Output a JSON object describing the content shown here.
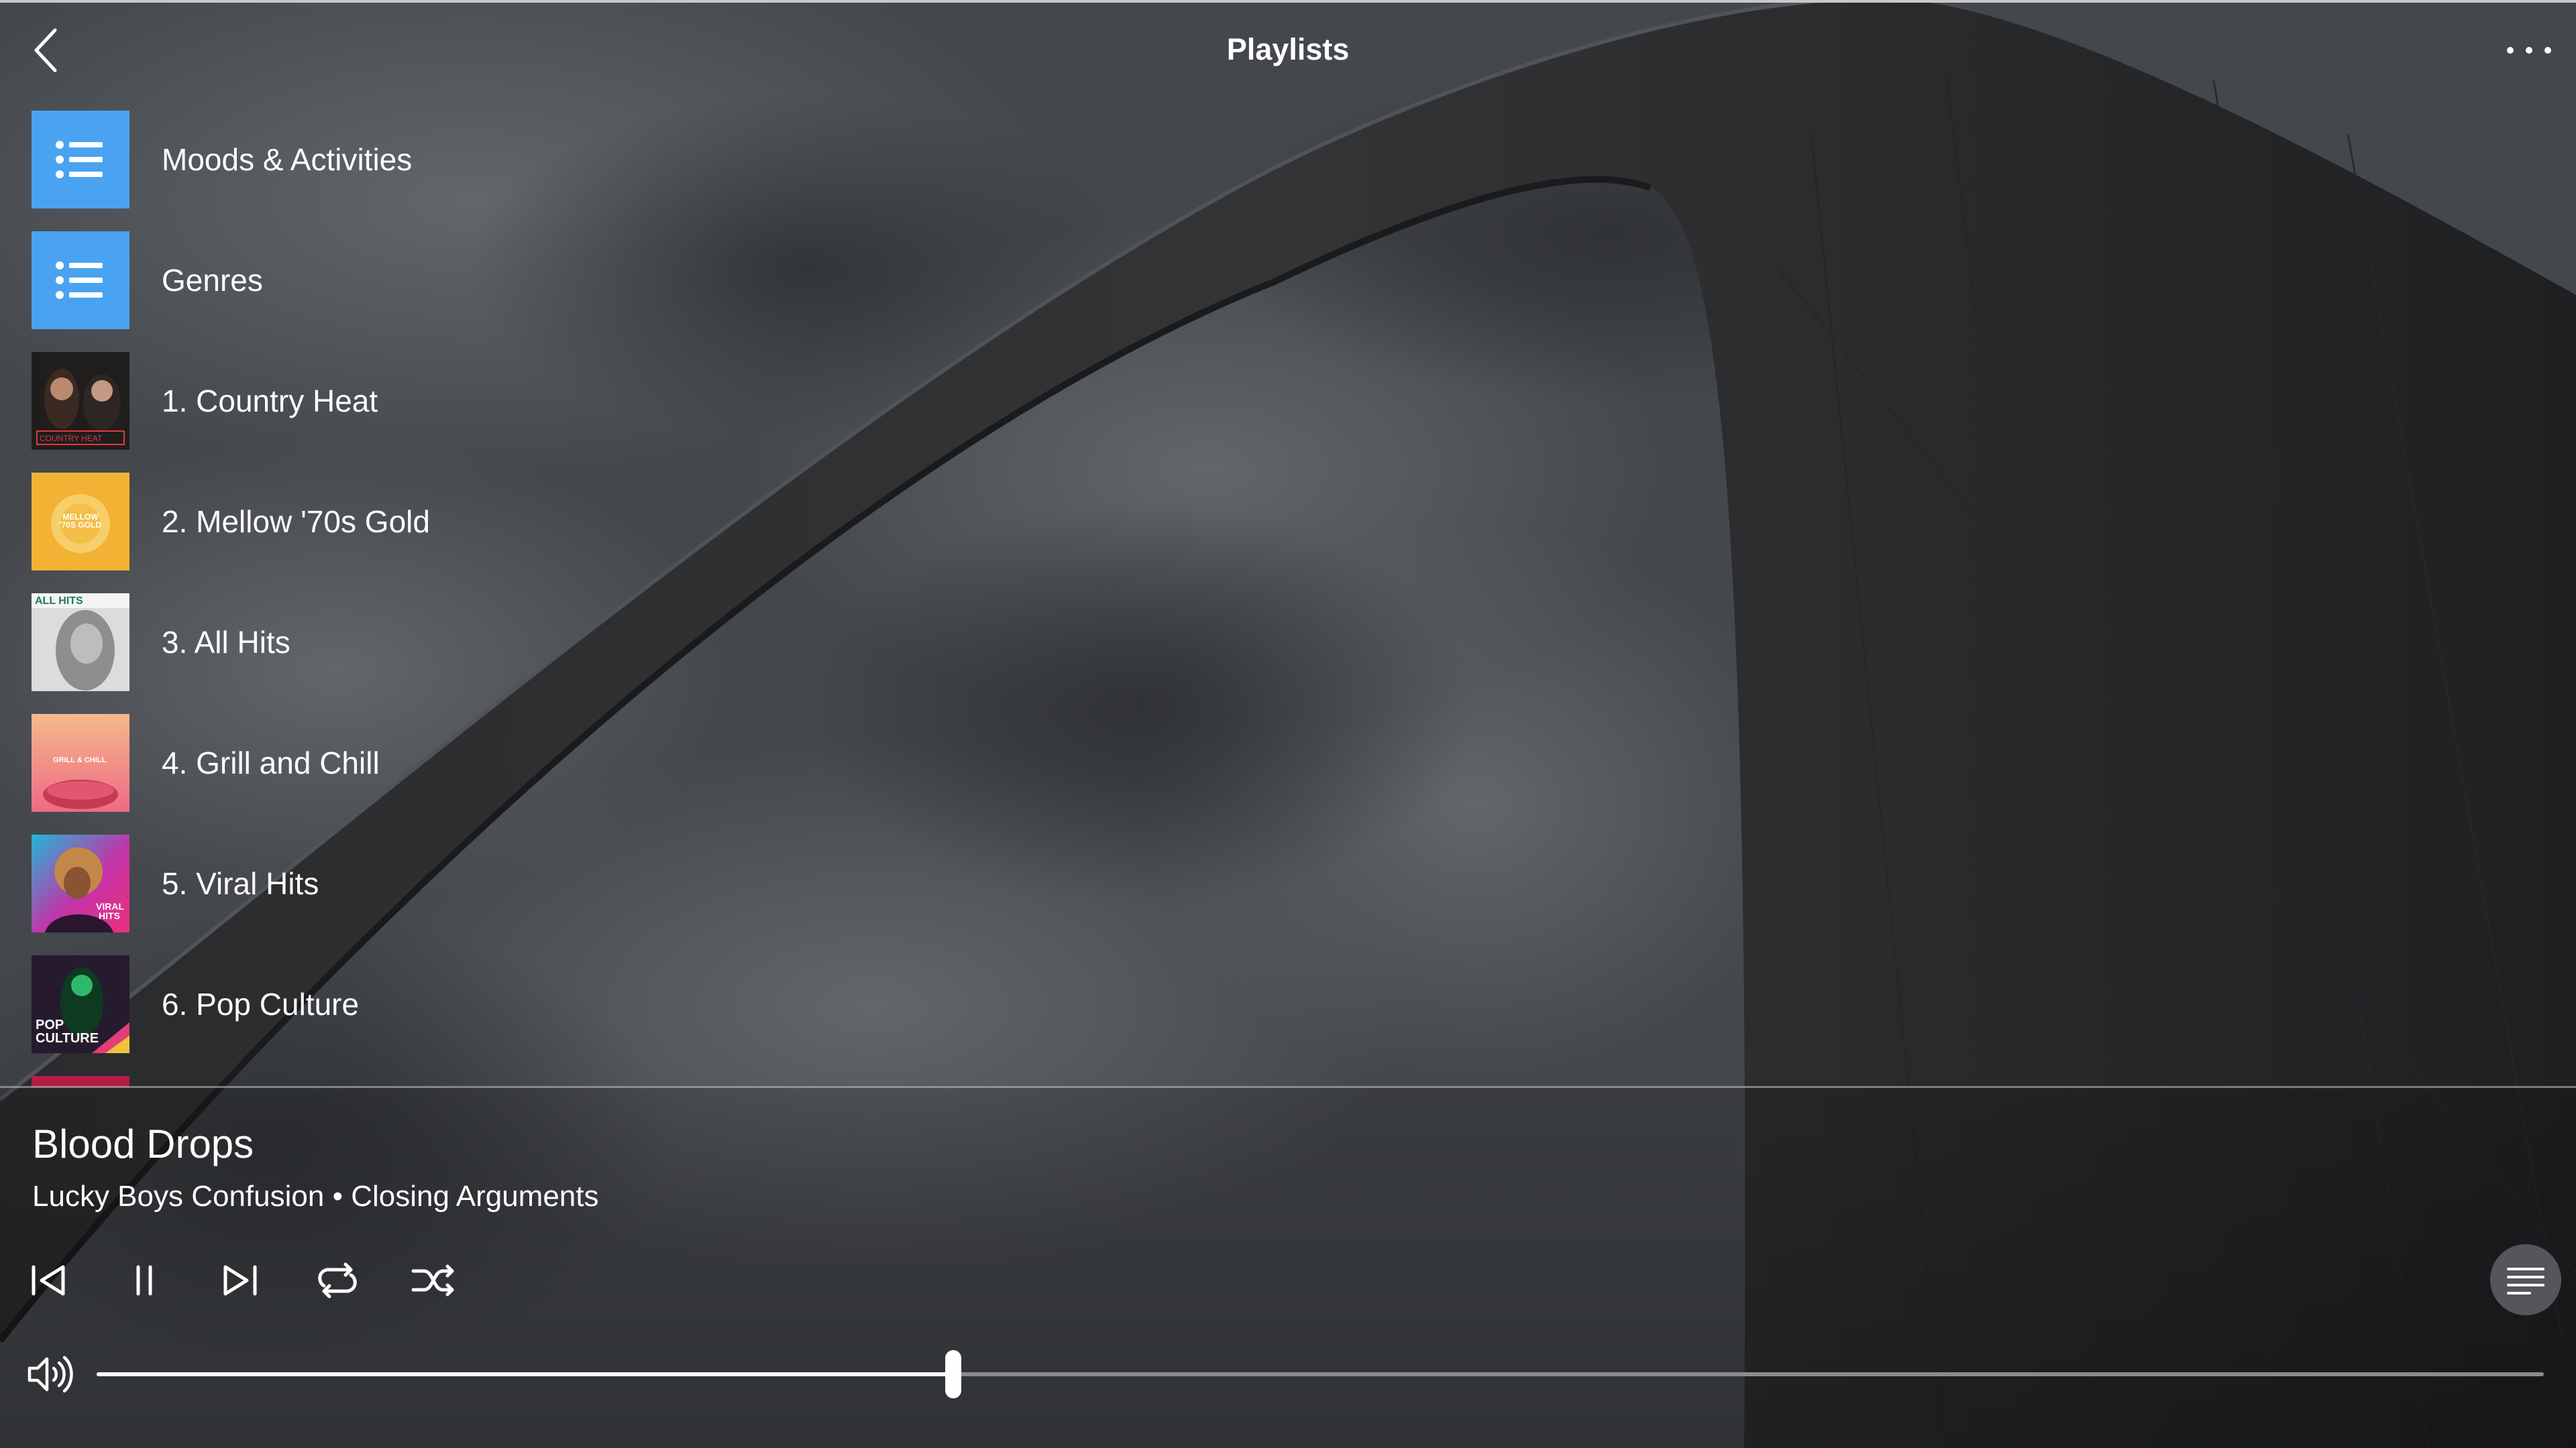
{
  "header": {
    "title": "Playlists",
    "back_icon": "chevron-left-icon",
    "more_icon": "more-horizontal-icon"
  },
  "playlists": [
    {
      "label": "Moods & Activities",
      "thumb": "list-icon"
    },
    {
      "label": "Genres",
      "thumb": "list-icon"
    },
    {
      "label": "1. Country Heat",
      "thumb_text": "COUNTRY HEAT"
    },
    {
      "label": "2. Mellow '70s Gold",
      "thumb_text": "MELLOW '70S GOLD"
    },
    {
      "label": "3. All Hits",
      "thumb_text": "ALL HITS"
    },
    {
      "label": "4. Grill and Chill",
      "thumb_text": "GRILL & CHILL"
    },
    {
      "label": "5. Viral Hits",
      "thumb_text": "VIRAL HITS"
    },
    {
      "label": "6. Pop Culture",
      "thumb_text": "POP CULTURE"
    }
  ],
  "now_playing": {
    "title": "Blood Drops",
    "subtitle": "Lucky Boys Confusion • Closing Arguments",
    "controls": [
      "previous-icon",
      "pause-icon",
      "next-icon",
      "repeat-icon",
      "shuffle-icon"
    ],
    "queue_icon": "queue-list-icon",
    "volume_icon": "volume-icon",
    "progress": 0.35
  },
  "colors": {
    "accent_tile": "#4aa3f0",
    "text": "#ffffff"
  }
}
